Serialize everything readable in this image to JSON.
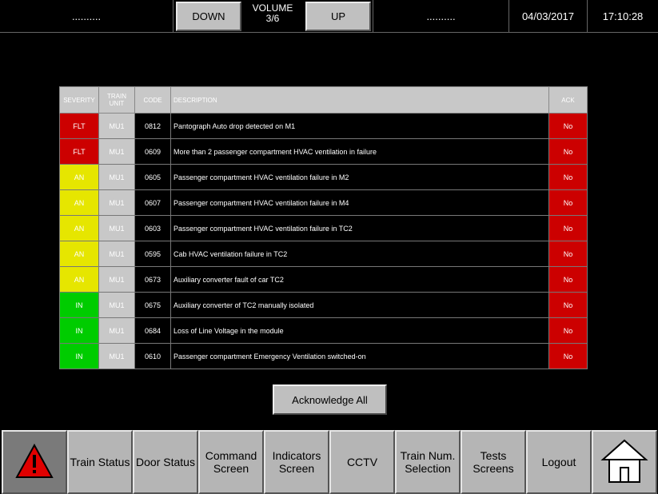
{
  "header": {
    "left_field": "..........",
    "down_label": "DOWN",
    "volume_label": "VOLUME",
    "volume_value": "3/6",
    "up_label": "UP",
    "center_field": "..........",
    "date": "04/03/2017",
    "time": "17:10:28"
  },
  "table": {
    "headers": {
      "severity": "SEVERITY",
      "train_unit": "TRAIN UNIT",
      "code": "CODE",
      "description": "DESCRIPTION",
      "ack": "ACK"
    },
    "rows": [
      {
        "severity": "FLT",
        "unit": "MU1",
        "code": "0812",
        "description": "Pantograph Auto drop detected on M1",
        "ack": "No"
      },
      {
        "severity": "FLT",
        "unit": "MU1",
        "code": "0609",
        "description": "More than 2 passenger compartment HVAC ventilation in failure",
        "ack": "No"
      },
      {
        "severity": "AN",
        "unit": "MU1",
        "code": "0605",
        "description": "Passenger compartment HVAC ventilation failure in M2",
        "ack": "No"
      },
      {
        "severity": "AN",
        "unit": "MU1",
        "code": "0607",
        "description": "Passenger compartment HVAC ventilation failure in M4",
        "ack": "No"
      },
      {
        "severity": "AN",
        "unit": "MU1",
        "code": "0603",
        "description": "Passenger compartment HVAC ventilation failure in TC2",
        "ack": "No"
      },
      {
        "severity": "AN",
        "unit": "MU1",
        "code": "0595",
        "description": "Cab HVAC ventilation failure in TC2",
        "ack": "No"
      },
      {
        "severity": "AN",
        "unit": "MU1",
        "code": "0673",
        "description": "Auxiliary converter fault of car TC2",
        "ack": "No"
      },
      {
        "severity": "IN",
        "unit": "MU1",
        "code": "0675",
        "description": "Auxiliary converter of TC2 manually isolated",
        "ack": "No"
      },
      {
        "severity": "IN",
        "unit": "MU1",
        "code": "0684",
        "description": "Loss of Line Voltage in the module",
        "ack": "No"
      },
      {
        "severity": "IN",
        "unit": "MU1",
        "code": "0610",
        "description": "Passenger compartment Emergency Ventilation switched-on",
        "ack": "No"
      }
    ]
  },
  "severity_colors": {
    "FLT": "#cc0000",
    "AN": "#e6e600",
    "IN": "#00cc00"
  },
  "ack_all_label": "Acknowledge All",
  "nav": {
    "alarm_icon": "warning-triangle-icon",
    "train_status": "Train Status",
    "door_status": "Door Status",
    "command_screen": "Command Screen",
    "indicators_screen": "Indicators Screen",
    "cctv": "CCTV",
    "train_num_selection": "Train Num. Selection",
    "tests_screens": "Tests Screens",
    "logout": "Logout",
    "home_icon": "home-icon"
  }
}
